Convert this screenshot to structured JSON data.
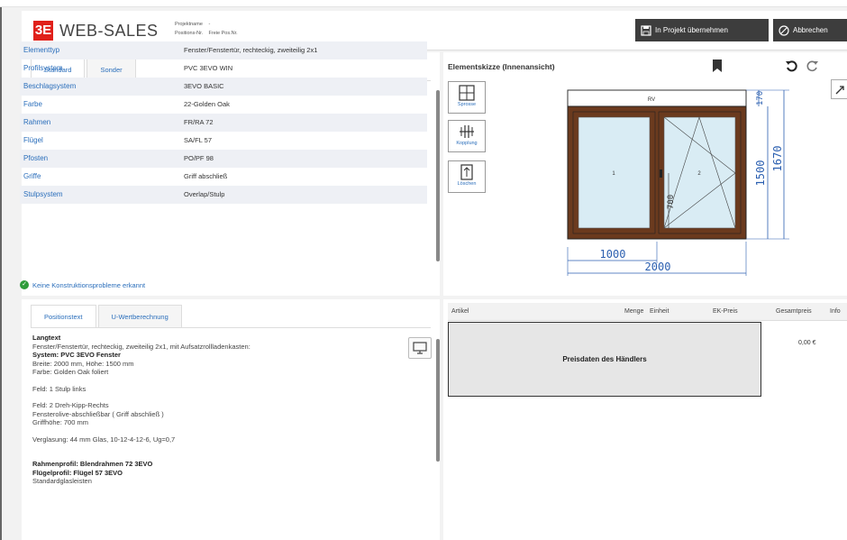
{
  "app": {
    "logo_text": "3E",
    "title": "WEB-SALES",
    "meta": [
      {
        "label": "Projektname",
        "value": "-"
      },
      {
        "label": "Positions-Nr.",
        "value": "Freie Pos.Nr."
      }
    ]
  },
  "header_buttons": {
    "take_over": "In Projekt übernehmen",
    "cancel": "Abbrechen"
  },
  "props_panel": {
    "tabs": [
      "Standard",
      "Sonder"
    ],
    "rows": [
      {
        "key": "Elementtyp",
        "value": "Fenster/Fenstertür, rechteckig, zweiteilig 2x1"
      },
      {
        "key": "Profilsystem",
        "value": "PVC 3EVO WIN"
      },
      {
        "key": "Beschlagsystem",
        "value": "3EVO BASIC"
      },
      {
        "key": "Farbe",
        "value": "22-Golden Oak"
      },
      {
        "key": "Rahmen",
        "value": "FR/RA 72"
      },
      {
        "key": "Flügel",
        "value": "SA/FL 57"
      },
      {
        "key": "Pfosten",
        "value": "PO/PF 98"
      },
      {
        "key": "Griffe",
        "value": "Griff abschließ"
      },
      {
        "key": "Stulpsystem",
        "value": "Overlap/Stulp"
      }
    ],
    "status": "Keine Konstruktionsprobleme erkannt"
  },
  "text_panel": {
    "tabs": [
      "Positionstext",
      "U-Wertberechnung"
    ],
    "heading": "Langtext",
    "lines": [
      {
        "text": "Fenster/Fenstertür, rechteckig, zweiteilig 2x1, mit Aufsatzrollladenkasten:",
        "bold": false
      },
      {
        "text": "System: PVC 3EVO Fenster",
        "bold": true
      },
      {
        "text": "Breite: 2000 mm, Höhe: 1500 mm",
        "bold": false
      },
      {
        "text": "Farbe: Golden Oak foliert",
        "bold": false
      },
      {
        "text": "",
        "bold": false
      },
      {
        "text": "Feld: 1 Stulp links",
        "bold": false
      },
      {
        "text": "",
        "bold": false
      },
      {
        "text": "Feld: 2 Dreh-Kipp-Rechts",
        "bold": false
      },
      {
        "text": "Fensterolive-abschließbar ( Griff abschließ )",
        "bold": false
      },
      {
        "text": "Griffhöhe: 700 mm",
        "bold": false
      },
      {
        "text": "",
        "bold": false
      },
      {
        "text": "Verglasung: 44 mm Glas, 10-12-4-12-6, Ug=0,7",
        "bold": false
      },
      {
        "text": "",
        "bold": false
      },
      {
        "text": "",
        "bold": false
      },
      {
        "text": "Rahmenprofil: Blendrahmen 72 3EVO",
        "bold": true
      },
      {
        "text": "Flügelprofil: Flügel 57 3EVO",
        "bold": true
      },
      {
        "text": "Standardglasleisten",
        "bold": false
      }
    ]
  },
  "sketch": {
    "title": "Elementskizze (Innenansicht)",
    "tools": [
      "Sprosse",
      "Kopplung",
      "Löschen"
    ],
    "box_label": "RV",
    "sash_labels": [
      "1",
      "2"
    ],
    "dims": {
      "total_width": "2000",
      "sash_width": "1000",
      "total_height": "1670",
      "window_height": "1500",
      "box_height": "170",
      "handle_height": "700"
    },
    "colors": {
      "frame": "#6b3a1e",
      "glass": "#d9ecf4",
      "dim": "#2b5fb0"
    }
  },
  "price_table": {
    "headers": [
      "Artikel",
      "Menge",
      "Einheit",
      "EK-Preis",
      "Gesamtpreis",
      "Info"
    ],
    "dealer_box": "Preisdaten des Händlers",
    "total": "0,00 €"
  }
}
